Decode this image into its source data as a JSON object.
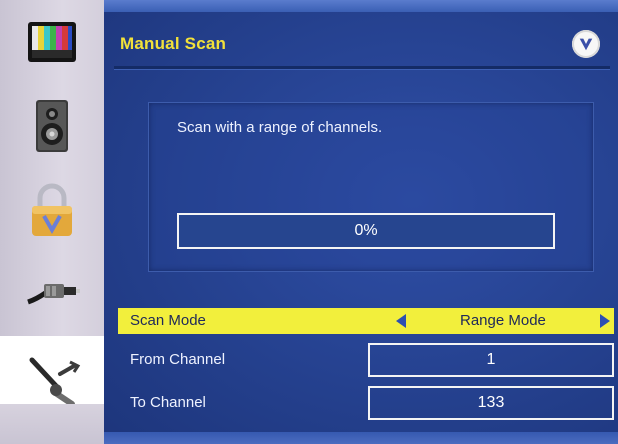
{
  "sidebar": {
    "items": [
      {
        "icon": "tv-picture-icon"
      },
      {
        "icon": "speaker-icon"
      },
      {
        "icon": "parental-lock-icon"
      },
      {
        "icon": "cable-connector-icon"
      },
      {
        "icon": "tools-icon",
        "selected": true
      }
    ]
  },
  "header": {
    "title": "Manual Scan",
    "logo_icon": "vizio-logo-icon"
  },
  "scan_box": {
    "message": "Scan with a range of channels.",
    "progress_percent": 0,
    "progress_text": "0%"
  },
  "settings": {
    "scan_mode": {
      "label": "Scan Mode",
      "value": "Range Mode"
    },
    "from_channel": {
      "label": "From Channel",
      "value": "1"
    },
    "to_channel": {
      "label": "To Channel",
      "value": "133"
    }
  },
  "colors": {
    "title_yellow": "#f2e13a",
    "highlight_yellow": "#f2ef3c",
    "panel_blue": "#25418f",
    "arrow_blue": "#2d4fb1"
  }
}
